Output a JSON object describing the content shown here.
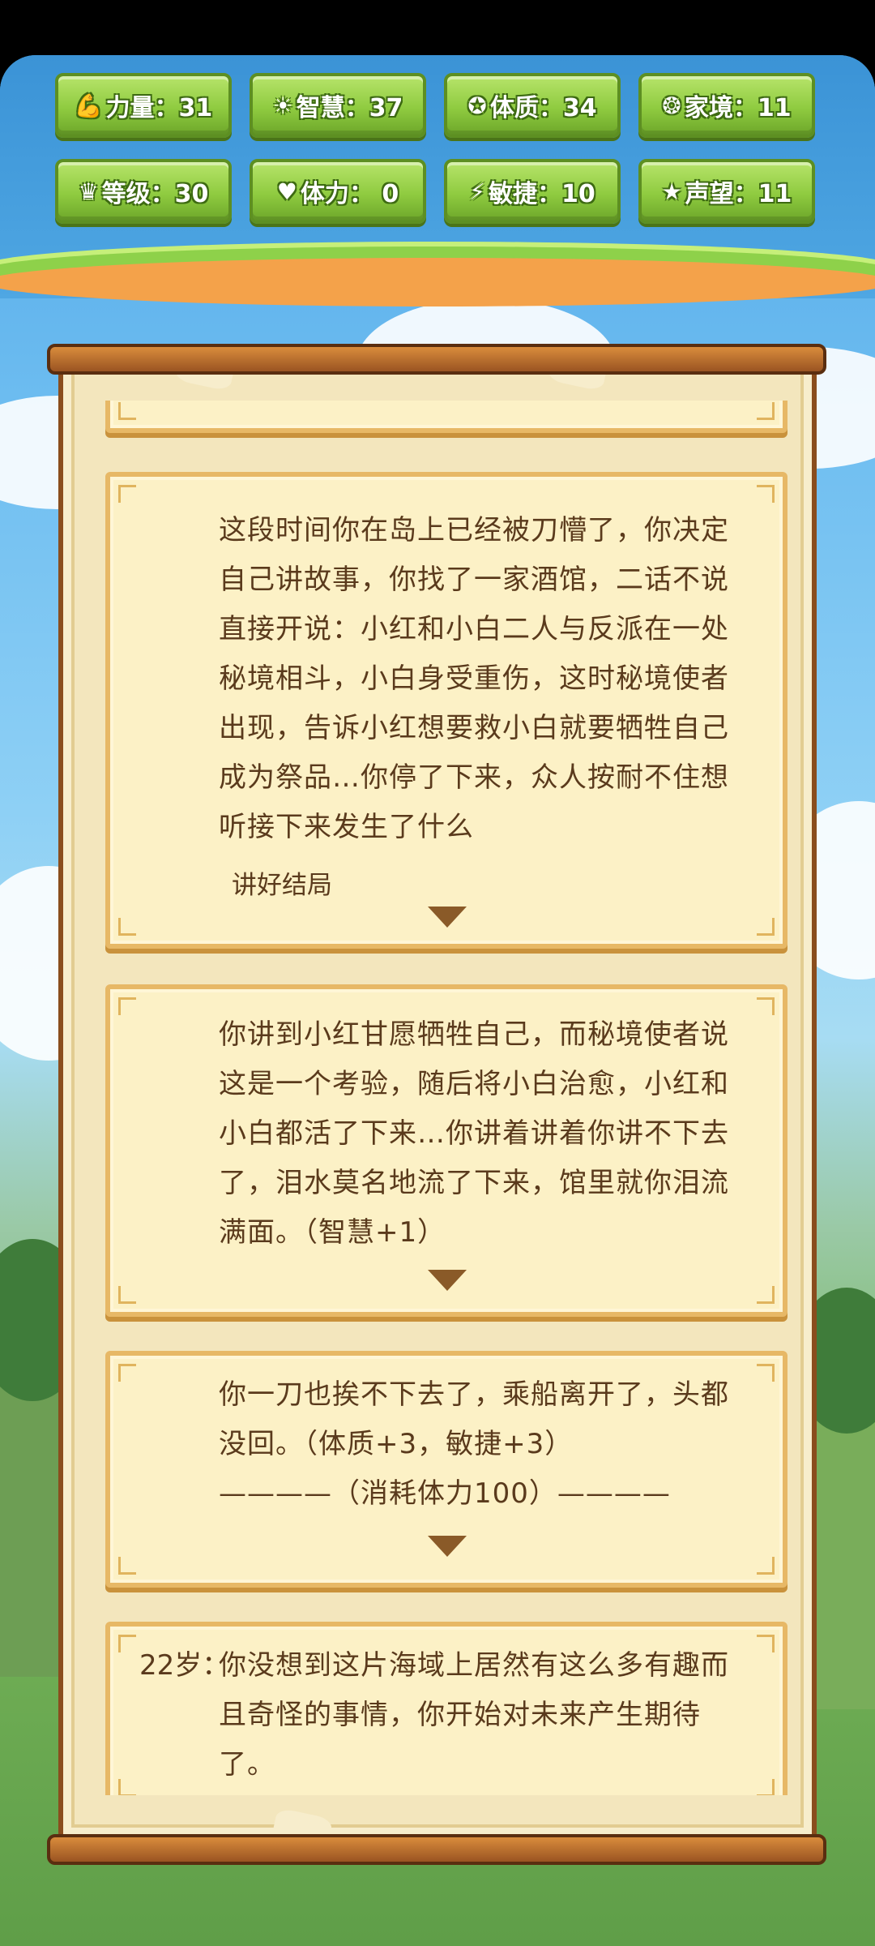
{
  "stats": [
    {
      "icon": "strength-icon",
      "glyph": "💪",
      "label": "力量：31"
    },
    {
      "icon": "wisdom-icon",
      "glyph": "☀",
      "label": "智慧：37"
    },
    {
      "icon": "constitution-icon",
      "glyph": "✪",
      "label": "体质：34"
    },
    {
      "icon": "family-icon",
      "glyph": "❂",
      "label": "家境：11"
    },
    {
      "icon": "crown-icon",
      "glyph": "♛",
      "label": "等级：30"
    },
    {
      "icon": "heart-icon",
      "glyph": "♥",
      "label": "体力：  0"
    },
    {
      "icon": "lightning-icon",
      "glyph": "⚡",
      "label": "敏捷：10"
    },
    {
      "icon": "star-icon",
      "glyph": "★",
      "label": "声望：11"
    }
  ],
  "cards": [
    {
      "text": "这段时间你在岛上已经被刀懵了，你决定自己讲故事，你找了一家酒馆，二话不说直接开说：小红和小白二人与反派在一处秘境相斗，小白身受重伤，这时秘境使者出现，告诉小红想要救小白就要牺牲自己成为祭品…你停了下来，众人按耐不住想听接下来发生了什么",
      "choice": "讲好结局"
    },
    {
      "text": "你讲到小红甘愿牺牲自己，而秘境使者说这是一个考验，随后将小白治愈，小红和小白都活了下来…你讲着讲着你讲不下去了，泪水莫名地流了下来，馆里就你泪流满面。（智慧+1）"
    },
    {
      "text": "你一刀也挨不下去了，乘船离开了，头都没回。（体质+3，敏捷+3）",
      "cost": "————（消耗体力100）————"
    },
    {
      "age": "22岁：",
      "text": "你没想到这片海域上居然有这么多有趣而且奇怪的事情，你开始对未来产生期待了。"
    }
  ]
}
